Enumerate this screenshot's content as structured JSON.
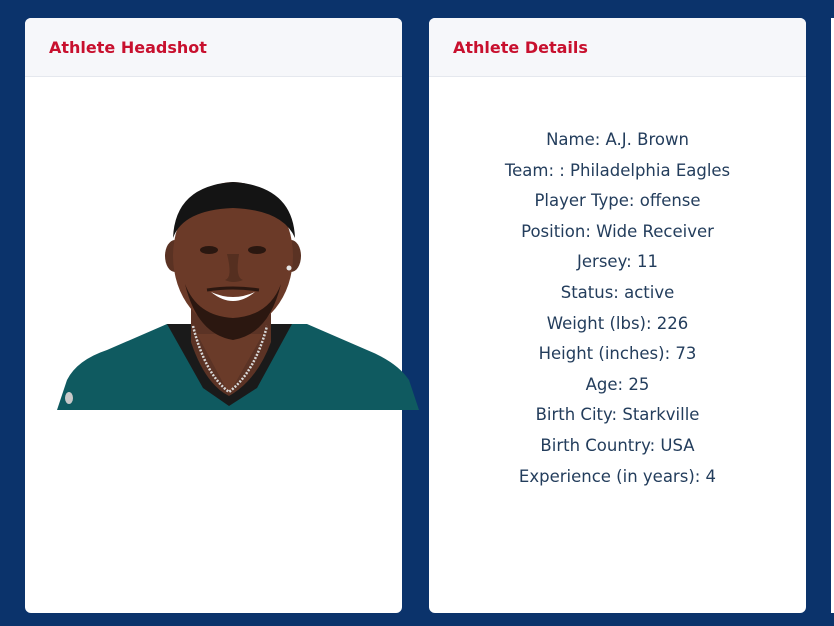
{
  "headshot_card": {
    "title": "Athlete Headshot",
    "image_icon": "athlete-photo"
  },
  "details_card": {
    "title": "Athlete Details",
    "rows": [
      {
        "label": "Name",
        "value": "A.J. Brown",
        "text": "Name: A.J. Brown"
      },
      {
        "label": "Team",
        "value": ": Philadelphia Eagles",
        "text": "Team: : Philadelphia Eagles"
      },
      {
        "label": "Player Type",
        "value": "offense",
        "text": "Player Type: offense"
      },
      {
        "label": "Position",
        "value": "Wide Receiver",
        "text": "Position: Wide Receiver"
      },
      {
        "label": "Jersey",
        "value": "11",
        "text": "Jersey: 11"
      },
      {
        "label": "Status",
        "value": "active",
        "text": "Status: active"
      },
      {
        "label": "Weight (lbs)",
        "value": "226",
        "text": "Weight (lbs): 226"
      },
      {
        "label": "Height (inches)",
        "value": "73",
        "text": "Height (inches): 73"
      },
      {
        "label": "Age",
        "value": "25",
        "text": "Age: 25"
      },
      {
        "label": "Birth City",
        "value": "Starkville",
        "text": "Birth City: Starkville"
      },
      {
        "label": "Birth Country",
        "value": "USA",
        "text": "Birth Country: USA"
      },
      {
        "label": "Experience (in years)",
        "value": "4",
        "text": "Experience (in years): 4"
      }
    ]
  },
  "colors": {
    "background": "#0b336b",
    "card": "#ffffff",
    "header_bg": "#f6f7fa",
    "title": "#c8102e",
    "text": "#233d5c",
    "jersey": "#0f5a60"
  }
}
